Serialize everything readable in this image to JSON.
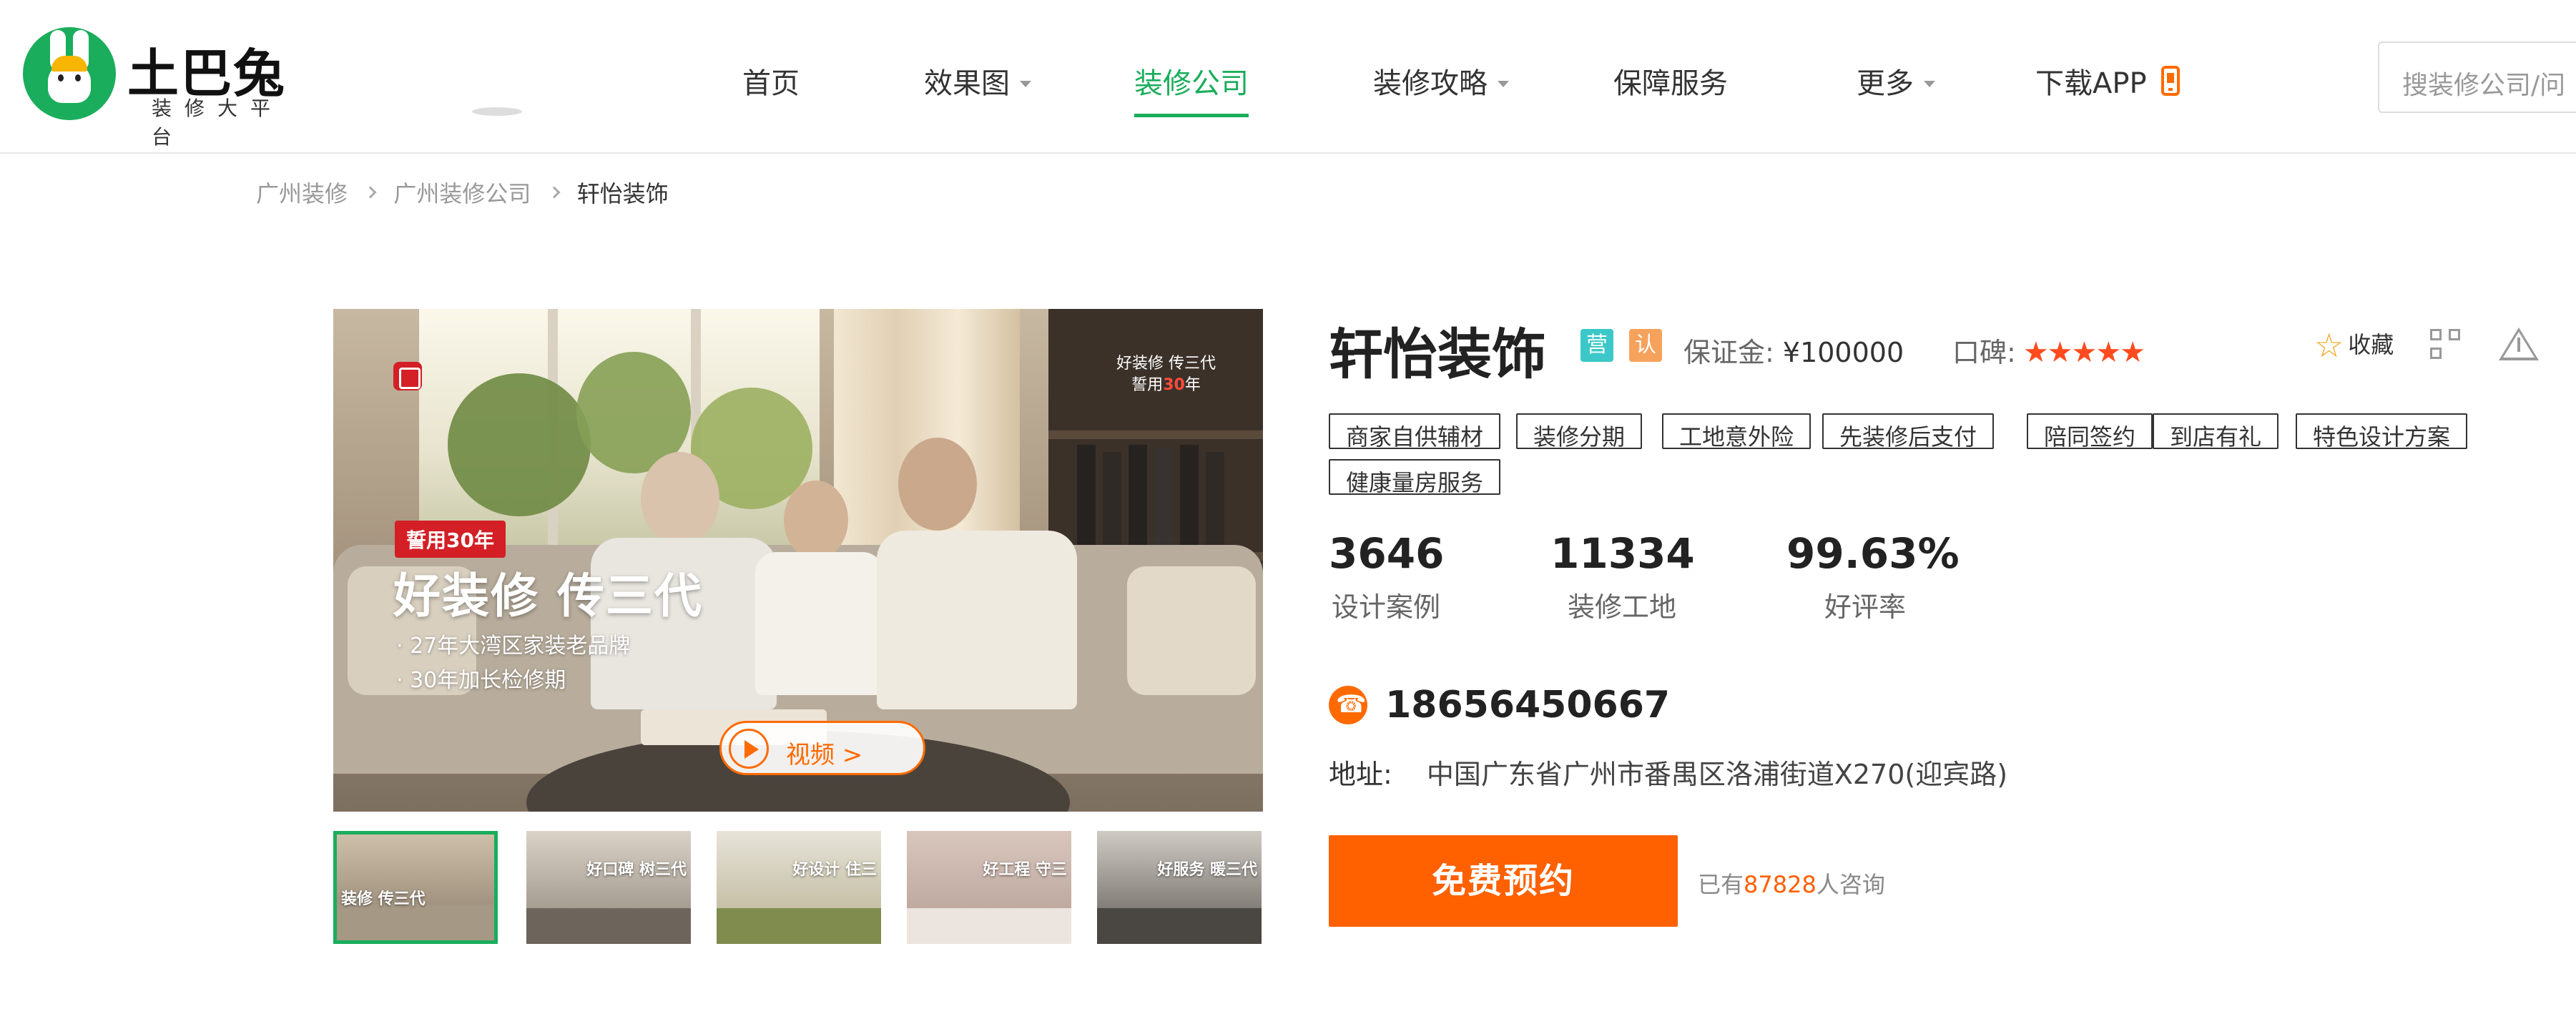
{
  "brand": {
    "name": "土巴兔",
    "tagline": "装修大平台"
  },
  "nav": {
    "items": [
      {
        "label": "首页"
      },
      {
        "label": "效果图"
      },
      {
        "label": "装修公司"
      },
      {
        "label": "装修攻略"
      },
      {
        "label": "保障服务"
      },
      {
        "label": "更多"
      },
      {
        "label": "下载APP"
      }
    ],
    "search_placeholder": "搜装修公司/问"
  },
  "breadcrumb": [
    "广州装修",
    "广州装修公司",
    "轩怡装饰"
  ],
  "gallery": {
    "slogan_top": "好装修 传三代",
    "slogan_top_2": "誓用",
    "slogan_top_year": "30",
    "slogan_top_3": "年",
    "badge": "誓用30年",
    "headline": "好装修 传三代",
    "bullets": [
      "· 27年大湾区家装老品牌",
      "· 30年加长检修期"
    ],
    "video_label": "视频 >",
    "thumbs": [
      {
        "label": "装修 传三代"
      },
      {
        "label": "好口碑 树三代"
      },
      {
        "label": "好设计 住三"
      },
      {
        "label": "好工程 守三"
      },
      {
        "label": "好服务 暖三代"
      }
    ]
  },
  "company": {
    "name": "轩怡装饰",
    "badge_1": "营",
    "badge_2": "认",
    "deposit_label": "保证金:",
    "deposit_value": "¥100000",
    "rating_label": "口碑:",
    "rating_stars": 5,
    "rating_glyphs": "★★★★★",
    "favorite_label": "收藏",
    "tags": [
      "商家自供辅材",
      "装修分期",
      "工地意外险",
      "先装修后支付",
      "陪同签约",
      "到店有礼",
      "特色设计方案",
      "健康量房服务"
    ],
    "stats": [
      {
        "value": "3646",
        "label": "设计案例"
      },
      {
        "value": "11334",
        "label": "装修工地"
      },
      {
        "value": "99.63%",
        "label": "好评率"
      }
    ],
    "phone": "18656450667",
    "address_label": "地址:",
    "address_value": "中国广东省广州市番禺区洛浦街道X270(迎宾路)",
    "book_button": "免费预约",
    "consult_prefix": "已有",
    "consult_count": "87828",
    "consult_suffix": "人咨询"
  },
  "colors": {
    "brand_green": "#1aad5c",
    "accent_orange": "#ff6000",
    "star_red": "#ff4b1e"
  }
}
